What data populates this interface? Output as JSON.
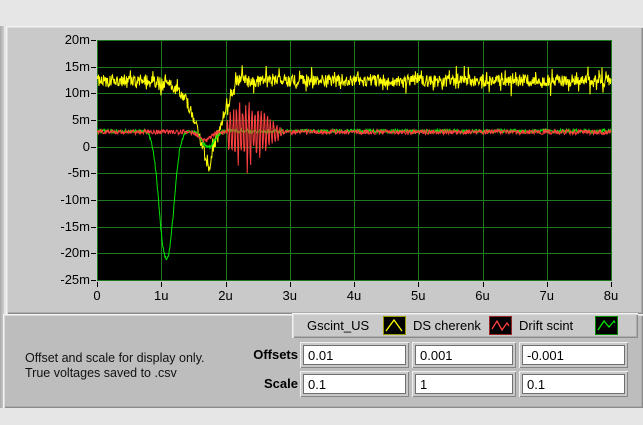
{
  "window": {
    "bg": "#e6e6e6",
    "panel_bg": "#c9c9c9",
    "lower_panel_bg": "#bdbdbd"
  },
  "legend": {
    "items": [
      {
        "label": "Gscint_US",
        "color": "#ffff00"
      },
      {
        "label": "DS cherenk",
        "color": "#ff4040"
      },
      {
        "label": "Drift scint",
        "color": "#00e600"
      }
    ]
  },
  "note": {
    "line1": "Offset and scale for display only.",
    "line2": "True voltages saved to .csv"
  },
  "offsets": {
    "label": "Offsets",
    "values": [
      "0.01",
      "0.001",
      "-0.001"
    ]
  },
  "scale": {
    "label": "Scale",
    "values": [
      "0.1",
      "1",
      "0.1"
    ]
  },
  "chart_data": {
    "type": "line",
    "title": "",
    "xlabel": "",
    "ylabel": "",
    "plot_bg": "#000000",
    "grid": true,
    "grid_color": "#1f7a1f",
    "x_axis": {
      "min": 0,
      "max": 8,
      "unit": "microseconds",
      "ticks": [
        "0",
        "1u",
        "2u",
        "3u",
        "4u",
        "5u",
        "6u",
        "7u",
        "8u"
      ]
    },
    "y_axis": {
      "min": -25,
      "max": 20,
      "unit": "millivolts",
      "ticks": [
        "20m",
        "15m",
        "10m",
        "5m",
        "0",
        "-5m",
        "-10m",
        "-15m",
        "-20m",
        "-25m"
      ]
    },
    "legend_position": "bottom-right",
    "draw_order": [
      0,
      2,
      1
    ],
    "series": [
      {
        "name": "Gscint_US",
        "color": "#ffff00",
        "baseline_mv": 12.4,
        "noise_mv": 1.15,
        "spiky": true,
        "features": [
          {
            "type": "dip",
            "center": 1.73,
            "width": 0.26,
            "pow": 1.3,
            "depth_mv": 16.2
          },
          {
            "type": "bump",
            "center": 2.21,
            "width": 0.12,
            "height_mv": 2.0
          }
        ]
      },
      {
        "name": "DS cherenk",
        "color": "#ff4040",
        "baseline_mv": 2.75,
        "noise_mv": 0.45,
        "spiky": false,
        "features": [
          {
            "type": "dip",
            "center": 1.68,
            "width": 0.12,
            "pow": 2,
            "depth_mv": 1.6
          },
          {
            "type": "burst",
            "start": 2.02,
            "end": 2.97,
            "center": 2.28,
            "peak_mv": 8.0,
            "tail_center": 2.66,
            "tail_peak_mv": 2.6,
            "period": 0.048
          }
        ]
      },
      {
        "name": "Drift scint",
        "color": "#00e600",
        "baseline_mv": 2.9,
        "noise_mv": 0.38,
        "spiky": false,
        "features": [
          {
            "type": "dip",
            "center": 1.08,
            "width": 0.155,
            "pow": 2.2,
            "depth_mv": 23.8
          },
          {
            "type": "dip",
            "center": 1.73,
            "width": 0.13,
            "pow": 2,
            "depth_mv": 3.1
          }
        ]
      }
    ]
  }
}
